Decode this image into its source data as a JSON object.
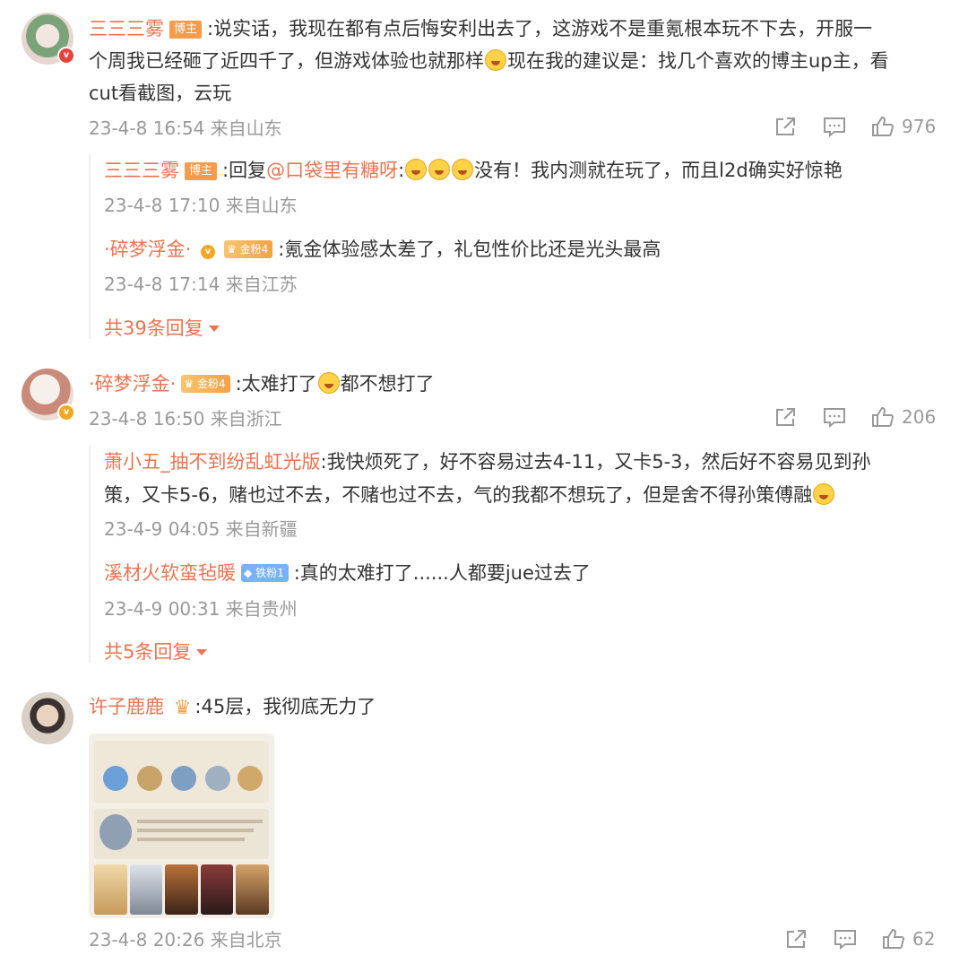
{
  "comments": [
    {
      "user": "三三三雾",
      "tag": "博主",
      "lines": [
        ":说实话，我现在都有点后悔安利出去了，这游戏不是重氪根本玩不下去，开服一",
        "个周我已经砸了近四千了，但游戏体验也就那样",
        "现在我的建议是：找几个喜欢的博主up主，看",
        "cut看截图，云玩"
      ],
      "time": "23-4-8 16:54 来自山东",
      "likes": "976",
      "replies": [
        {
          "user": "三三三雾",
          "tag": "博主",
          "prefix": ":回复",
          "mention": "@口袋里有糖呀",
          "text_a": ":",
          "text_b": "没有！我内测就在玩了，而且l2d确实好惊艳",
          "time": "23-4-8 17:10 来自山东"
        },
        {
          "user": "·碎梦浮金·",
          "fan_tag": "金粉4",
          "text": ":氪金体验感太差了，礼包性价比还是光头最高",
          "time": "23-4-8 17:14 来自江苏"
        }
      ],
      "more": "共39条回复"
    },
    {
      "user": "·碎梦浮金·",
      "fan_tag": "金粉4",
      "text_a": ":太难打了",
      "text_b": "都不想打了",
      "time": "23-4-8 16:50 来自浙江",
      "likes": "206",
      "replies": [
        {
          "user": "萧小五_抽不到纷乱虹光版",
          "line1": ":我快烦死了，好不容易过去4-11，又卡5-3，然后好不容易见到孙",
          "line2": "策，又卡5-6，赌也过不去，不赌也过不去，气的我都不想玩了，但是舍不得孙策傅融",
          "time": "23-4-9 04:05 来自新疆"
        },
        {
          "user": "溪材火软蛮毡暖",
          "fan_tag": "铁粉1",
          "text": ":真的太难打了......人都要jue过去了",
          "time": "23-4-9 00:31 来自贵州"
        }
      ],
      "more": "共5条回复"
    },
    {
      "user": "许子鹿鹿",
      "text": ":45层，我彻底无力了",
      "time": "23-4-8 20:26 来自北京",
      "likes": "62"
    }
  ],
  "colors": {
    "name": "#eb7350",
    "meta": "#999999",
    "text": "#333333"
  },
  "icons": [
    "share-icon",
    "comment-icon",
    "like-icon",
    "verified-icon",
    "crown-icon",
    "emoji-icon"
  ]
}
